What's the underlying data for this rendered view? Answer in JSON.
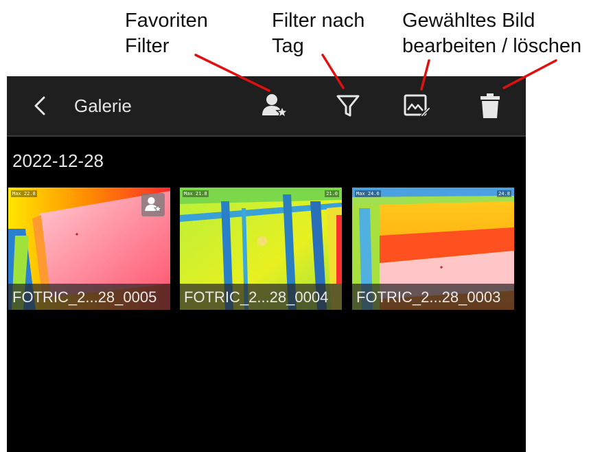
{
  "callouts": {
    "favorites_filter": "Favoriten\nFilter",
    "filter_by_tag": "Filter nach\nTag",
    "edit_delete": "Gewähltes Bild\nbearbeiten / löschen",
    "arrow_color": "#e01010"
  },
  "app_bar": {
    "title": "Galerie",
    "back_icon": "chevron-left-icon",
    "actions": [
      {
        "name": "favorites-filter",
        "icon": "person-star-icon"
      },
      {
        "name": "tag-filter",
        "icon": "funnel-icon"
      },
      {
        "name": "edit-image",
        "icon": "image-edit-icon"
      },
      {
        "name": "delete-image",
        "icon": "trash-icon"
      }
    ]
  },
  "gallery": {
    "date": "2022-12-28",
    "selection_color": "#1e6fff",
    "images": [
      {
        "caption": "FOTRIC_2...28_0005",
        "selected": true,
        "favorite": true,
        "overlay_left": "Max 22.8",
        "overlay_right": ""
      },
      {
        "caption": "FOTRIC_2...28_0004",
        "selected": false,
        "favorite": false,
        "overlay_left": "Max 21.8",
        "overlay_right": "21.0"
      },
      {
        "caption": "FOTRIC_2...28_0003",
        "selected": false,
        "favorite": false,
        "overlay_left": "Max 24.6",
        "overlay_right": "24.8"
      }
    ]
  }
}
